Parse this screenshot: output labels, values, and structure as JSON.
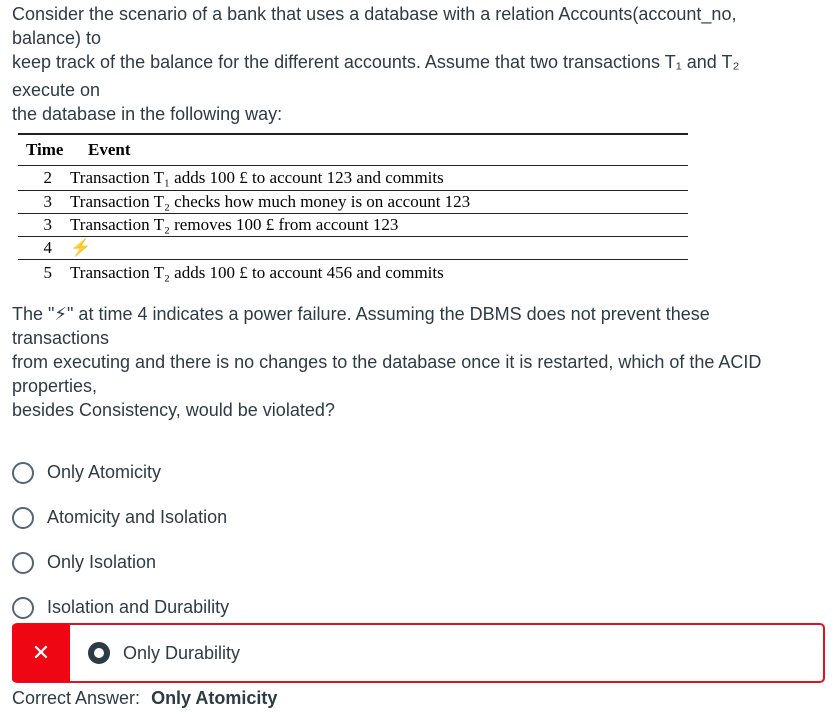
{
  "intro_lines": [
    "Consider the scenario of a bank that uses a database with a relation Accounts(account_no,",
    "balance) to",
    "keep track of the balance for the different accounts. Assume that two transactions T₁ and T₂",
    "execute on",
    "the database in the following way:"
  ],
  "table": {
    "headers": {
      "time": "Time",
      "event": "Event"
    },
    "rows": [
      {
        "time": "2",
        "event": "Transaction T₁ adds 100 £ to account 123 and commits"
      },
      {
        "time": "3",
        "event": "Transaction T₂ checks how much money is on account 123"
      },
      {
        "time": "3",
        "event": "Transaction T₂ removes 100 £ from account 123"
      },
      {
        "time": "4",
        "event": "⚡"
      },
      {
        "time": "5",
        "event": "Transaction T₂ adds 100 £ to account 456 and commits"
      }
    ]
  },
  "question_lines": [
    "The \"⚡\" at time 4 indicates a power failure. Assuming the DBMS does not prevent these",
    "transactions",
    "from executing and there is no changes to the database once it is restarted, which of the ACID",
    "properties,",
    "besides Consistency, would be violated?"
  ],
  "options": [
    {
      "label": "Only Atomicity"
    },
    {
      "label": "Atomicity and Isolation"
    },
    {
      "label": "Only Isolation"
    },
    {
      "label": "Isolation and Durability"
    }
  ],
  "selected_option": {
    "label": "Only Durability",
    "status_icon": "x-icon",
    "status_glyph": "✕",
    "status_color": "#ee0612"
  },
  "correct_answer": {
    "prefix": "Correct Answer:",
    "value": "Only Atomicity"
  }
}
